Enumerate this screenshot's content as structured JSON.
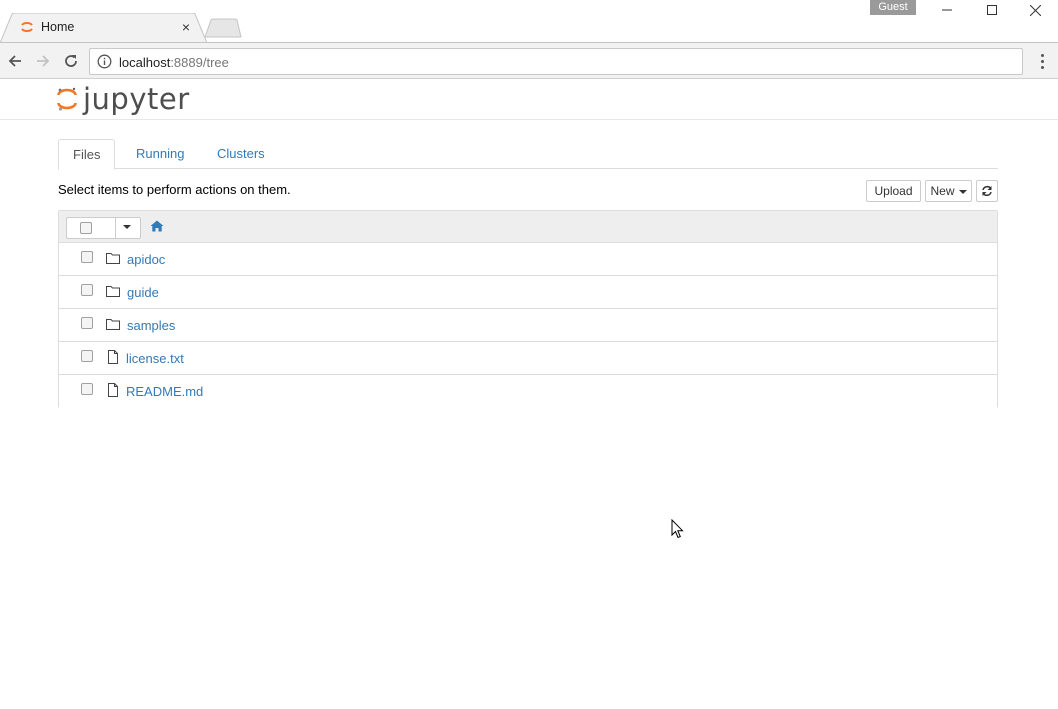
{
  "browser": {
    "tab_title": "Home",
    "tab_close": "×",
    "profile_badge": "Guest",
    "url_host": "localhost",
    "url_path": ":8889/tree"
  },
  "jupyter": {
    "logo_text": "jupyter",
    "tabs": [
      {
        "label": "Files",
        "active": true
      },
      {
        "label": "Running",
        "active": false
      },
      {
        "label": "Clusters",
        "active": false
      }
    ],
    "instructions": "Select items to perform actions on them.",
    "upload_label": "Upload",
    "new_label": "New",
    "files": [
      {
        "name": "apidoc",
        "type": "folder"
      },
      {
        "name": "guide",
        "type": "folder"
      },
      {
        "name": "samples",
        "type": "folder"
      },
      {
        "name": "license.txt",
        "type": "file"
      },
      {
        "name": "README.md",
        "type": "file"
      }
    ]
  },
  "colors": {
    "link": "#337ab7",
    "jupyter_orange": "#f37726"
  }
}
